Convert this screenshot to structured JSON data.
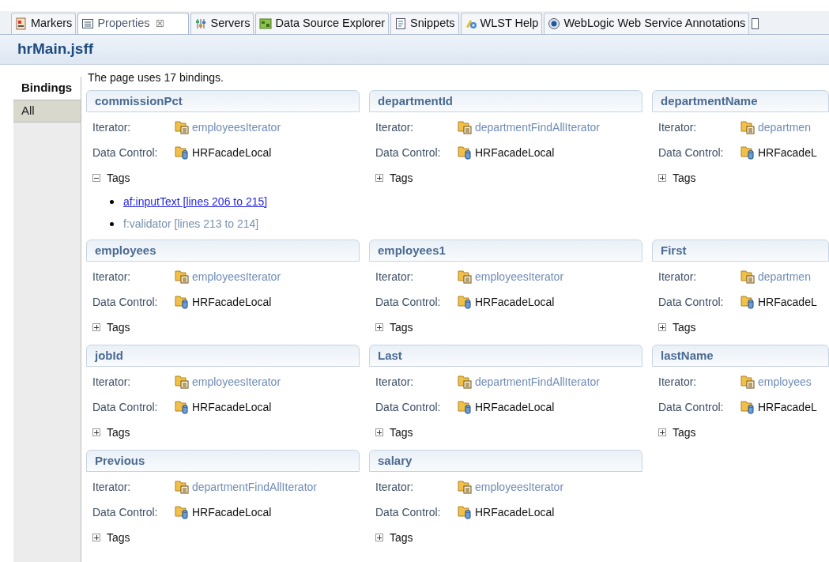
{
  "tabs": [
    {
      "label": "Markers",
      "selected": false
    },
    {
      "label": "Properties",
      "selected": true,
      "close": "☒"
    },
    {
      "label": "Servers",
      "selected": false
    },
    {
      "label": "Data Source Explorer",
      "selected": false
    },
    {
      "label": "Snippets",
      "selected": false
    },
    {
      "label": "WLST Help",
      "selected": false
    },
    {
      "label": "WebLogic Web Service Annotations",
      "selected": false
    }
  ],
  "title": "hrMain.jsff",
  "side_tabs": [
    {
      "label": "Bindings",
      "selected": true
    },
    {
      "label": "All",
      "selected": false
    }
  ],
  "summary": "The page uses 17 bindings.",
  "cards": [
    {
      "title": "commissionPct",
      "iterator_label": "Iterator:",
      "iterator": "employeesIterator",
      "control_label": "Data Control:",
      "control": "HRFacadeLocal",
      "tags_label": "Tags",
      "expanded": true,
      "tags": [
        {
          "text": "af:inputText [lines 206 to 215]",
          "link": true
        },
        {
          "text": "f:validator [lines 213 to 214]",
          "link": false
        }
      ]
    },
    {
      "title": "departmentId",
      "iterator_label": "Iterator:",
      "iterator": "departmentFindAllIterator",
      "control_label": "Data Control:",
      "control": "HRFacadeLocal",
      "tags_label": "Tags",
      "expanded": false
    },
    {
      "title": "departmentName",
      "iterator_label": "Iterator:",
      "iterator": "departmen",
      "control_label": "Data Control:",
      "control": "HRFacadeL",
      "tags_label": "Tags",
      "expanded": false
    },
    {
      "title": "employees",
      "iterator_label": "Iterator:",
      "iterator": "employeesIterator",
      "control_label": "Data Control:",
      "control": "HRFacadeLocal",
      "tags_label": "Tags",
      "expanded": false
    },
    {
      "title": "employees1",
      "iterator_label": "Iterator:",
      "iterator": "employeesIterator",
      "control_label": "Data Control:",
      "control": "HRFacadeLocal",
      "tags_label": "Tags",
      "expanded": false
    },
    {
      "title": "First",
      "iterator_label": "Iterator:",
      "iterator": "departmen",
      "control_label": "Data Control:",
      "control": "HRFacadeL",
      "tags_label": "Tags",
      "expanded": false
    },
    {
      "title": "jobId",
      "iterator_label": "Iterator:",
      "iterator": "employeesIterator",
      "control_label": "Data Control:",
      "control": "HRFacadeLocal",
      "tags_label": "Tags",
      "expanded": false
    },
    {
      "title": "Last",
      "iterator_label": "Iterator:",
      "iterator": "departmentFindAllIterator",
      "control_label": "Data Control:",
      "control": "HRFacadeLocal",
      "tags_label": "Tags",
      "expanded": false
    },
    {
      "title": "lastName",
      "iterator_label": "Iterator:",
      "iterator": "employees",
      "control_label": "Data Control:",
      "control": "HRFacadeL",
      "tags_label": "Tags",
      "expanded": false
    },
    {
      "title": "Previous",
      "iterator_label": "Iterator:",
      "iterator": "departmentFindAllIterator",
      "control_label": "Data Control:",
      "control": "HRFacadeLocal",
      "tags_label": "Tags",
      "expanded": false
    },
    {
      "title": "salary",
      "iterator_label": "Iterator:",
      "iterator": "employeesIterator",
      "control_label": "Data Control:",
      "control": "HRFacadeLocal",
      "tags_label": "Tags",
      "expanded": false
    }
  ]
}
